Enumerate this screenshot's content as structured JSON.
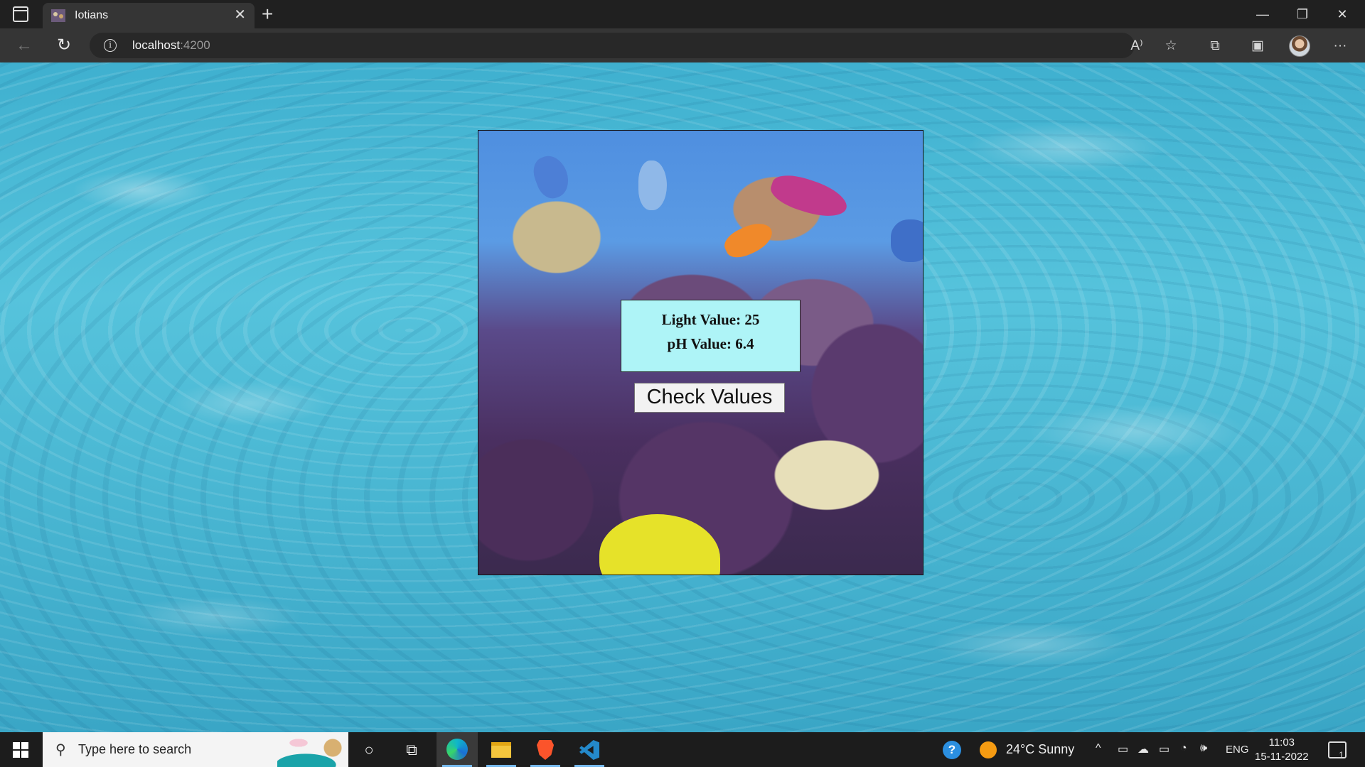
{
  "browser": {
    "tab_title": "Iotians",
    "url_host": "localhost",
    "url_port": ":4200",
    "icons": {
      "tab_actions": "tab-actions-icon",
      "close_tab": "close-icon",
      "new_tab": "plus-icon",
      "back": "back-arrow-icon",
      "refresh": "refresh-icon",
      "site_info": "info-icon",
      "read_aloud": "read-aloud-icon",
      "favorites": "star-add-icon",
      "extensions": "puzzle-icon",
      "collections": "collections-icon",
      "profile": "avatar",
      "more": "ellipsis-icon"
    },
    "glyphs": {
      "close": "✕",
      "plus": "+",
      "back": "←",
      "refresh": "↻",
      "info": "i",
      "read_aloud": "A⁾",
      "favorites": "☆",
      "extensions": "⧉",
      "collections": "▣",
      "more": "···",
      "minimize": "—",
      "restore": "❐",
      "close_window": "✕"
    }
  },
  "page": {
    "light_label": "Light Value: 25",
    "ph_label": "pH Value: 6.4",
    "check_button_label": "Check Values",
    "colors": {
      "values_box_bg": "#aef4f7",
      "water": "#49b6d2"
    }
  },
  "taskbar": {
    "search_placeholder": "Type here to search",
    "search_glyph": "⚲",
    "cortana_glyph": "○",
    "taskview_glyph": "⧉",
    "help_glyph": "?",
    "weather_text": "24°C  Sunny",
    "tray_glyphs": {
      "chevron": "^",
      "meet": "▭",
      "cloud": "☁",
      "battery": "▭",
      "wifi": "◔",
      "volume": "🕪"
    },
    "language": "ENG",
    "time": "11:03",
    "date": "15-11-2022",
    "notification_count": "1"
  }
}
